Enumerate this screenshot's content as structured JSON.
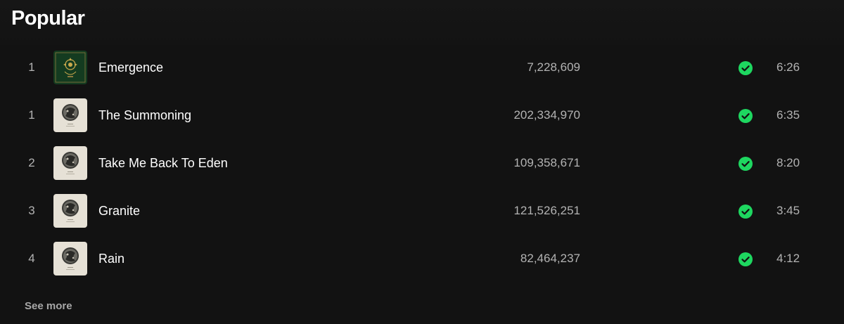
{
  "section": {
    "title": "Popular",
    "see_more_label": "See more"
  },
  "colors": {
    "background": "#121212",
    "accent_green": "#1ed760",
    "secondary_text": "#b3b3b3"
  },
  "tracks": [
    {
      "index": "1",
      "title": "Emergence",
      "plays": "7,228,609",
      "duration": "6:26",
      "saved": true,
      "cover": "green-ornate-cover-art"
    },
    {
      "index": "1",
      "title": "The Summoning",
      "plays": "202,334,970",
      "duration": "6:35",
      "saved": true,
      "cover": "cream-moon-cover-art"
    },
    {
      "index": "2",
      "title": "Take Me Back To Eden",
      "plays": "109,358,671",
      "duration": "8:20",
      "saved": true,
      "cover": "cream-moon-cover-art"
    },
    {
      "index": "3",
      "title": "Granite",
      "plays": "121,526,251",
      "duration": "3:45",
      "saved": true,
      "cover": "cream-moon-cover-art"
    },
    {
      "index": "4",
      "title": "Rain",
      "plays": "82,464,237",
      "duration": "4:12",
      "saved": true,
      "cover": "cream-moon-cover-art"
    }
  ]
}
